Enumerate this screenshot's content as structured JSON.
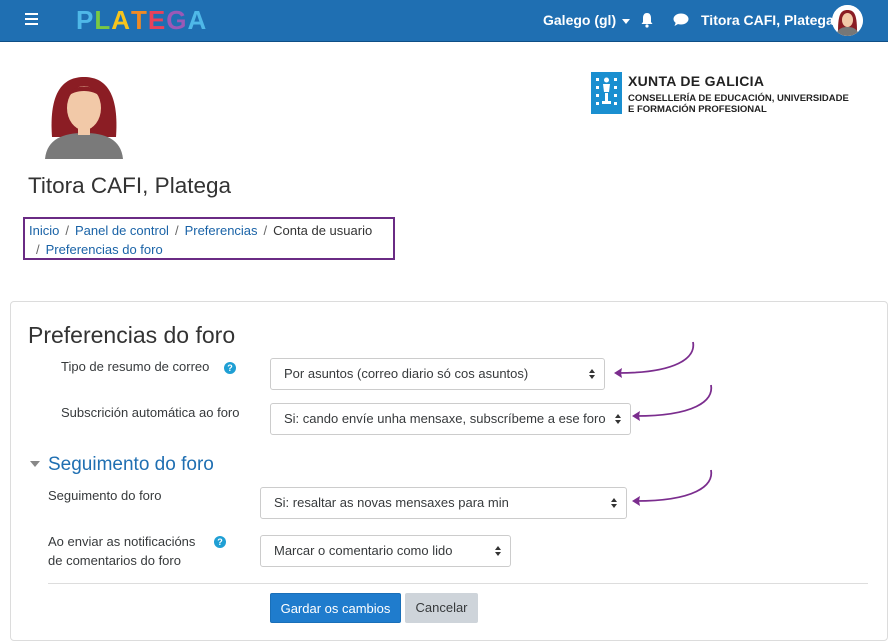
{
  "navbar": {
    "logo_text": "PLATEGA",
    "language": "Galego (gl)",
    "user_name": "Titora CAFI, Platega",
    "logo_colors": [
      "#4fb8e8",
      "#7ac943",
      "#f7c51d",
      "#f08a24",
      "#e9425b",
      "#9b59b6",
      "#4fb8e8"
    ]
  },
  "header": {
    "user_fullname": "Titora CAFI, Platega",
    "institution_title": "XUNTA DE GALICIA",
    "institution_sub1": "CONSELLERÍA DE EDUCACIÓN, UNIVERSIDADE",
    "institution_sub2": "E FORMACIÓN PROFESIONAL"
  },
  "breadcrumb": {
    "items": [
      "Inicio",
      "Panel de control",
      "Preferencias",
      "Conta de usuario",
      "Preferencias do foro"
    ],
    "separator": "/"
  },
  "form": {
    "title": "Preferencias do foro",
    "digest_label": "Tipo de resumo de correo",
    "digest_value": "Por asuntos (correo diario só cos asuntos)",
    "autosub_label": "Subscrición automática ao foro",
    "autosub_value": "Si: cando envíe unha mensaxe, subscríbeme a ese foro",
    "tracking_section": "Seguimento do foro",
    "tracking_label": "Seguimento do foro",
    "tracking_value": "Si: resaltar as novas mensaxes para min",
    "notify_label_line1": "Ao enviar as notificacións",
    "notify_label_line2": "de comentarios do foro",
    "notify_value": "Marcar o comentario como lido",
    "help_glyph": "?",
    "save_label": "Gardar os cambios",
    "cancel_label": "Cancelar"
  },
  "colors": {
    "navbar": "#1f6fb2",
    "link": "#1a63a7",
    "highlight_border": "#6a2b84",
    "arrow": "#7b2d8e",
    "primary_button": "#1f7ccd"
  }
}
